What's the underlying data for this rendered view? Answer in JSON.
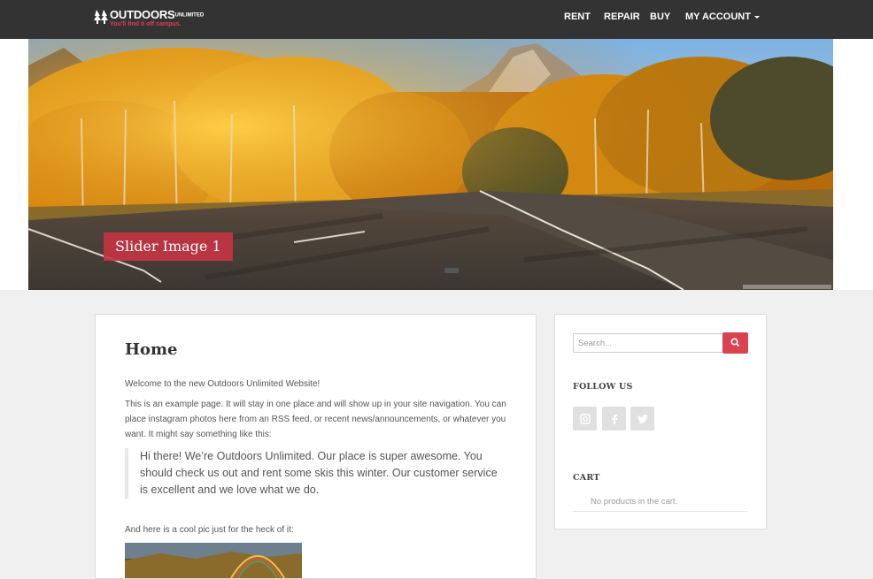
{
  "brand": {
    "name_main": "OUTDOORS",
    "name_small": "UNLIMITED",
    "tagline": "You'll find it off campus."
  },
  "nav": {
    "rent": "RENT",
    "repair": "REPAIR",
    "buy": "BUY",
    "account": "MY ACCOUNT"
  },
  "slider": {
    "caption": "Slider Image 1"
  },
  "page": {
    "title": "Home",
    "intro": "Welcome to the new Outdoors Unlimited Website!",
    "body": "This is an example page. It will stay in one place and will show up in your site navigation. You can place instagram photos here from an RSS feed, or recent news/announcements, or whatever you want. It might say something like this:",
    "quote": "Hi there! We’re Outdoors Unlimited. Our place is super awesome. You should check us out and rent some skis this winter. Our customer service is excellent and we love what we do.",
    "pic_caption": "And here is a cool pic just for the heck of it:"
  },
  "sidebar": {
    "search_placeholder": "Search...",
    "follow_heading": "FOLLOW US",
    "social_icons": [
      "instagram-icon",
      "facebook-icon",
      "twitter-icon"
    ],
    "cart_heading": "CART",
    "cart_empty": "No products in the cart."
  },
  "colors": {
    "navbar": "#333333",
    "accent": "#d9434f",
    "background": "#f0f0f0"
  }
}
